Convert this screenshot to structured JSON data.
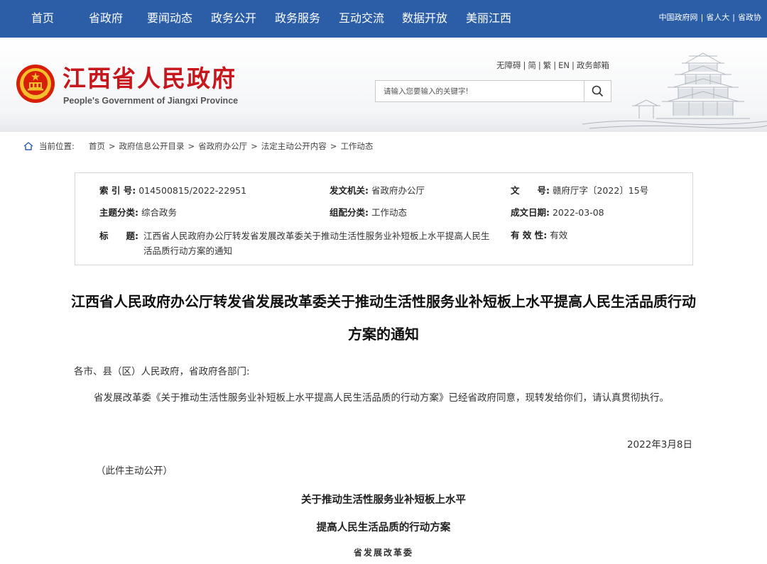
{
  "nav": {
    "items": [
      "首页",
      "省政府",
      "要闻动态",
      "政务公开",
      "政务服务",
      "互动交流",
      "数据开放",
      "美丽江西"
    ],
    "right_links": [
      "中国政府网",
      "省人大",
      "省政协"
    ]
  },
  "header": {
    "title": "江西省人民政府",
    "subtitle": "People's Government of Jiangxi Province",
    "util_links": [
      "无障碍",
      "简",
      "繁",
      "EN",
      "政务邮箱"
    ],
    "search_placeholder": "请输入您要输入的关键字!"
  },
  "breadcrumb": {
    "label": "当前位置:",
    "items": [
      "首页",
      "政府信息公开目录",
      "省政府办公厅",
      "法定主动公开内容",
      "工作动态"
    ]
  },
  "info": {
    "index_label": "索 引 号:",
    "index_value": "014500815/2022-22951",
    "issuer_label": "发文机关:",
    "issuer_value": "省政府办公厅",
    "docno_label": "文　　号:",
    "docno_value": "赣府厅字〔2022〕15号",
    "topic_label": "主题分类:",
    "topic_value": "综合政务",
    "category_label": "组配分类:",
    "category_value": "工作动态",
    "date_label": "成文日期:",
    "date_value": "2022-03-08",
    "title_label": "标　　题:",
    "title_value": "江西省人民政府办公厅转发省发展改革委关于推动生活性服务业补短板上水平提高人民生活品质行动方案的通知",
    "validity_label": "有 效 性:",
    "validity_value": "有效"
  },
  "article": {
    "title": "江西省人民政府办公厅转发省发展改革委关于推动生活性服务业补短板上水平提高人民生活品质行动方案的通知",
    "salutation": "各市、县（区）人民政府，省政府各部门:",
    "body": "省发展改革委《关于推动生活性服务业补短板上水平提高人民生活品质的行动方案》已经省政府同意，现转发给你们，请认真贯彻执行。",
    "date": "2022年3月8日",
    "note": "（此件主动公开）",
    "plan_title_1": "关于推动生活性服务业补短板上水平",
    "plan_title_2": "提高人民生活品质的行动方案",
    "plan_issuer": "省发展改革委"
  },
  "colors": {
    "nav_bg": "#2b5ea7",
    "title_red": "#c8161d"
  },
  "icons": [
    "emblem-icon",
    "search-icon",
    "home-icon",
    "pavilion-illustration"
  ]
}
